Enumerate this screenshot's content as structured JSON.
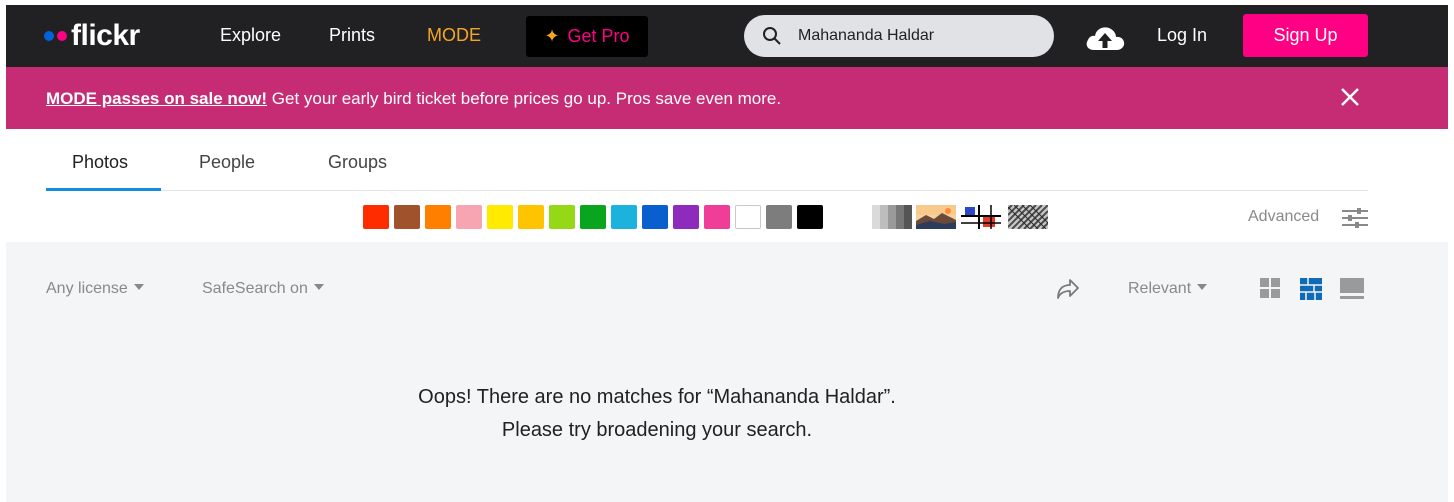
{
  "nav": {
    "logo_text": "flickr",
    "links": [
      "Explore",
      "Prints",
      "MODE"
    ],
    "get_pro": "Get Pro",
    "search_value": "Mahananda Haldar",
    "login": "Log In",
    "signup": "Sign Up"
  },
  "banner": {
    "link_text": "MODE passes on sale now!",
    "text": " Get your early bird ticket before prices go up. Pros save even more."
  },
  "tabs": [
    "Photos",
    "People",
    "Groups"
  ],
  "colors": [
    "#ff2c00",
    "#a0522d",
    "#ff7f00",
    "#f6a5b1",
    "#ffea00",
    "#ffc400",
    "#94d816",
    "#0aa51f",
    "#1bb2de",
    "#0a5fcf",
    "#8e2bbd",
    "#f03e98",
    "#ffffff",
    "#7d7d7d",
    "#000000"
  ],
  "advanced": "Advanced",
  "filters": {
    "license": "Any license",
    "safesearch": "SafeSearch on",
    "sort": "Relevant"
  },
  "empty": {
    "line1": "Oops! There are no matches for “Mahananda Haldar”.",
    "line2": "Please try broadening your search."
  },
  "icons": [
    "search-icon",
    "upload-cloud-icon",
    "close-icon",
    "advanced-sliders-icon",
    "share-icon",
    "grid-view-icon",
    "justified-view-icon",
    "list-view-icon"
  ]
}
